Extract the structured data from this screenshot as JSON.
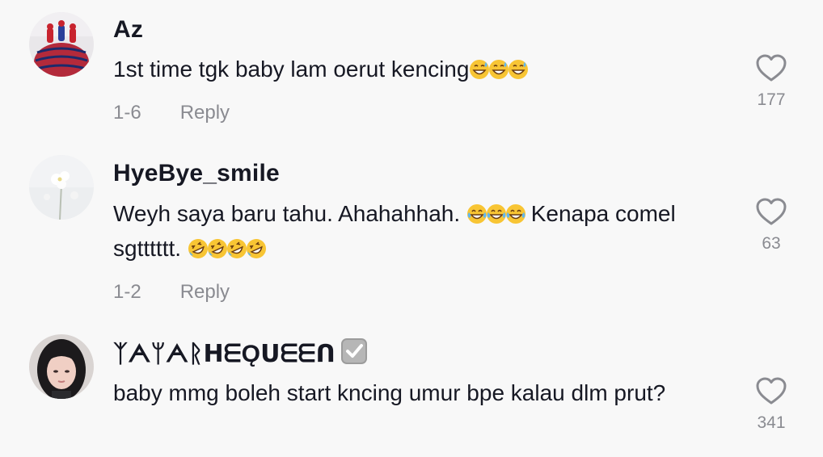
{
  "comments": [
    {
      "username": "Az",
      "text": "1st time tgk baby lam oerut kencing",
      "emojis": [
        "grinning-sweat-emoji",
        "grinning-sweat-emoji",
        "grinning-sweat-emoji"
      ],
      "date": "1-6",
      "reply_label": "Reply",
      "likes": "177",
      "avatar": "spiderman-cake-avatar"
    },
    {
      "username": "HyeBye_smile",
      "text": "Weyh saya baru tahu. Ahahahhah.",
      "emojis_mid": [
        "tears-of-joy-emoji",
        "tears-of-joy-emoji",
        "tears-of-joy-emoji"
      ],
      "text_after": "Kenapa comel sgtttttt.",
      "emojis": [
        "rolling-laughing-emoji",
        "rolling-laughing-emoji",
        "rolling-laughing-emoji",
        "rolling-laughing-emoji"
      ],
      "date": "1-2",
      "reply_label": "Reply",
      "likes": "63",
      "avatar": "flower-avatar"
    },
    {
      "username": "ᛉᗅᛘᗅᚱᕼᗴǪᑌᗴᗴᑎ",
      "verified_icon": "check-box-icon",
      "text": "baby mmg boleh start kncing umur bpe kalau dlm prut?",
      "likes": "341",
      "avatar": "girl-avatar"
    }
  ],
  "colors": {
    "background": "#f8f8f8",
    "primary_text": "#161823",
    "secondary_text": "#8a8b91"
  }
}
